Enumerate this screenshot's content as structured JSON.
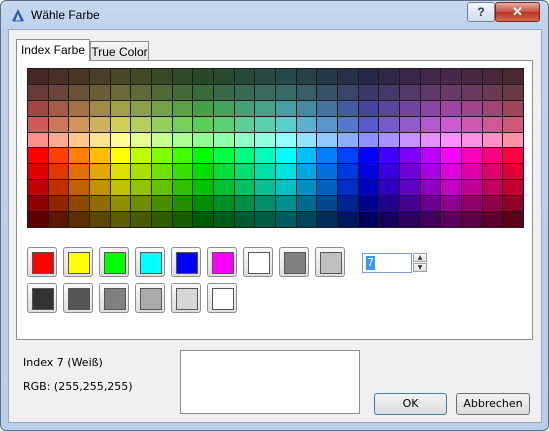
{
  "window": {
    "title": "Wähle Farbe",
    "help_label": "?",
    "close_label": "✕"
  },
  "tabs": [
    {
      "label": "Index Farbe"
    },
    {
      "label": "True Color"
    }
  ],
  "palette": {
    "hues": [
      0,
      15,
      30,
      45,
      60,
      75,
      90,
      105,
      120,
      135,
      150,
      165,
      180,
      195,
      210,
      225,
      240,
      255,
      270,
      285,
      300,
      315,
      330,
      345
    ],
    "rows": [
      {
        "s": 30,
        "l": 22
      },
      {
        "s": 30,
        "l": 32
      },
      {
        "s": 40,
        "l": 45
      },
      {
        "s": 55,
        "l": 58
      },
      {
        "s": 100,
        "l": 78
      },
      {
        "s": 100,
        "l": 50
      },
      {
        "s": 100,
        "l": 44
      },
      {
        "s": 100,
        "l": 38
      },
      {
        "s": 100,
        "l": 28
      },
      {
        "s": 100,
        "l": 18
      }
    ]
  },
  "standard_colors": [
    "#ff0000",
    "#ffff00",
    "#00ff00",
    "#00ffff",
    "#0000ff",
    "#ff00ff",
    "#ffffff",
    "#808080",
    "#c0c0c0"
  ],
  "gray_colors": [
    "#333333",
    "#555555",
    "#808080",
    "#aaaaaa",
    "#d6d6d6",
    "#ffffff"
  ],
  "index_input": {
    "value": "7"
  },
  "info": {
    "index_label": "Index 7 (Weiß)",
    "rgb_label": "RGB: (255,255,255)"
  },
  "preview_color": "#ffffff",
  "buttons": {
    "ok_label": "OK",
    "cancel_label": "Abbrechen"
  }
}
